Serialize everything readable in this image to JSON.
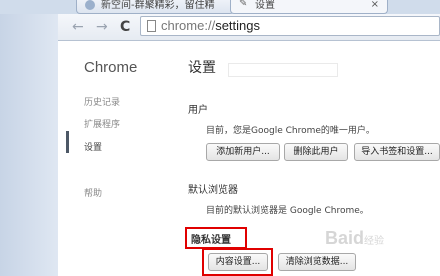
{
  "tabs": [
    {
      "label": "新空间-群聚精彩，留住精"
    },
    {
      "label": "设置",
      "close": "×"
    }
  ],
  "toolbar": {
    "back": "←",
    "forward": "→",
    "reload": "C",
    "url_scheme": "chrome://",
    "url_path": "settings"
  },
  "sidebar": {
    "title": "Chrome",
    "items": [
      {
        "label": "历史记录"
      },
      {
        "label": "扩展程序"
      },
      {
        "label": "设置"
      },
      {
        "label": "帮助"
      }
    ]
  },
  "main": {
    "title": "设置",
    "users": {
      "heading": "用户",
      "text": "目前，您是Google Chrome的唯一用户。",
      "buttons": [
        "添加新用户...",
        "删除此用户",
        "导入书签和设置..."
      ]
    },
    "default_browser": {
      "heading": "默认浏览器",
      "text": "目前的默认浏览器是 Google Chrome。"
    },
    "privacy": {
      "heading": "隐私设置",
      "buttons": [
        "内容设置...",
        "清除浏览数据..."
      ]
    }
  },
  "watermark": {
    "text": "Baid",
    "suffix": "经验"
  },
  "colors": {
    "highlight": "#e00000"
  }
}
